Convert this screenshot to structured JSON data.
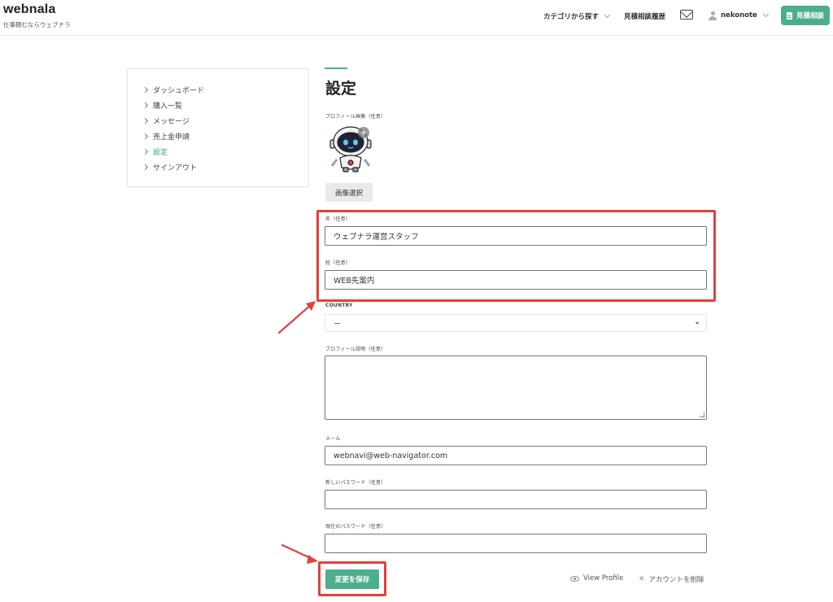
{
  "header": {
    "brand": "webnala",
    "tagline": "仕事頼むならウェブナラ",
    "nav_categories": "カテゴリから探す",
    "nav_history": "見積相談履歴",
    "user_name": "nekonote",
    "cta_label": "見積相談"
  },
  "sidebar": {
    "items": [
      {
        "label": "ダッシュボード"
      },
      {
        "label": "購入一覧"
      },
      {
        "label": "メッセージ"
      },
      {
        "label": "売上金申請"
      },
      {
        "label": "設定",
        "active": true
      },
      {
        "label": "サインアウト"
      }
    ]
  },
  "main": {
    "title": "設定",
    "profile_image_label": "プロフィール画像（任意）",
    "choose_image_label": "画像選択",
    "first_name_label": "名（任意）",
    "first_name_value": "ウェブナラ運営スタッフ",
    "last_name_label": "姓（任意）",
    "last_name_value": "WEB先案内",
    "country_label": "COUNTRY",
    "country_value": "ー",
    "bio_label": "プロフィール説明（任意）",
    "bio_value": "",
    "email_label": "メール",
    "email_value": "webnavi@web-navigator.com",
    "new_password_label": "新しいパスワード（任意）",
    "new_password_value": "",
    "current_password_label": "現在のパスワード（任意）",
    "current_password_value": "",
    "save_label": "変更を保存",
    "view_profile_label": "View Profile",
    "delete_account_label": "アカウントを削除"
  },
  "colors": {
    "accent": "#4dae8c",
    "annotation": "#e0413d"
  }
}
